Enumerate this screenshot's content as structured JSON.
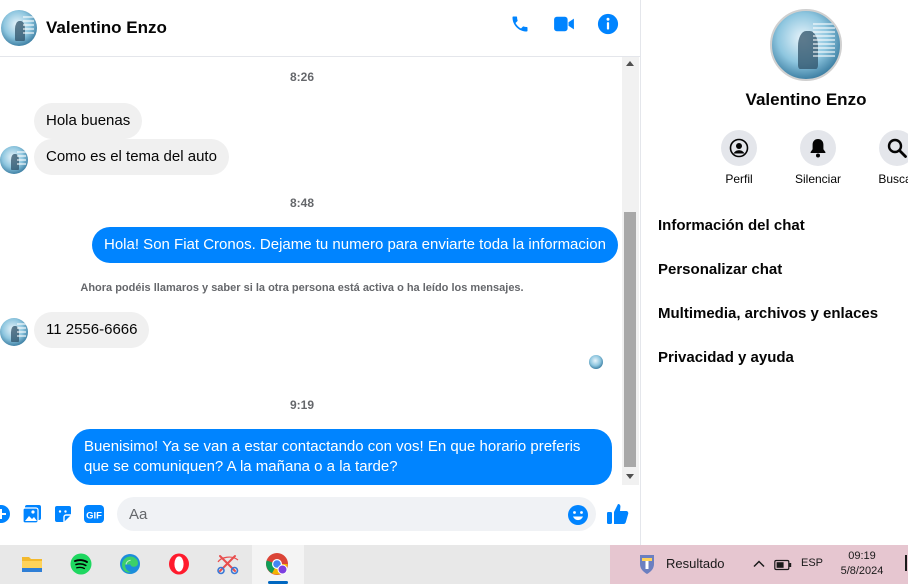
{
  "header": {
    "contact_name": "Valentino Enzo",
    "icons": [
      "phone-icon",
      "video-camera-icon",
      "info-icon"
    ]
  },
  "colors": {
    "accent": "#0084ff",
    "incoming_bubble": "#f0f0f0",
    "text_secondary": "#65676b"
  },
  "messages": {
    "time_1": "8:26",
    "msg_1": "Hola buenas",
    "msg_2": "Como es el tema del auto",
    "time_2": "8:48",
    "msg_3": "Hola! Son Fiat Cronos. Dejame tu numero para enviarte toda la informacion",
    "system_note": "Ahora podéis llamaros y saber si la otra persona está activa o ha leído los mensajes.",
    "msg_4": "11 2556-6666",
    "time_3": "9:19",
    "msg_5": "Buenisimo! Ya se van a estar contactando con vos! En que horario preferis que se comuniquen? A la mañana o a la tarde?"
  },
  "composer": {
    "placeholder": "Aa",
    "icons": [
      "plus-circle-icon",
      "gallery-icon",
      "sticker-icon",
      "gif-icon",
      "emoji-icon",
      "thumbs-up-icon"
    ],
    "gif_label": "GIF"
  },
  "info_panel": {
    "name": "Valentino Enzo",
    "actions": [
      {
        "label": "Perfil",
        "icon": "profile-icon"
      },
      {
        "label": "Silenciar",
        "icon": "bell-icon"
      },
      {
        "label": "Buscar",
        "icon": "search-icon"
      }
    ],
    "menu": [
      "Información del chat",
      "Personalizar chat",
      "Multimedia, archivos y enlaces",
      "Privacidad y ayuda"
    ]
  },
  "taskbar": {
    "apps": [
      "file-explorer-icon",
      "spotify-icon",
      "edge-icon",
      "opera-icon",
      "snipping-tool-icon",
      "chrome-icon"
    ],
    "widget_label": "Resultado",
    "language": "ESP",
    "time": "09:19",
    "date": "5/8/2024"
  }
}
